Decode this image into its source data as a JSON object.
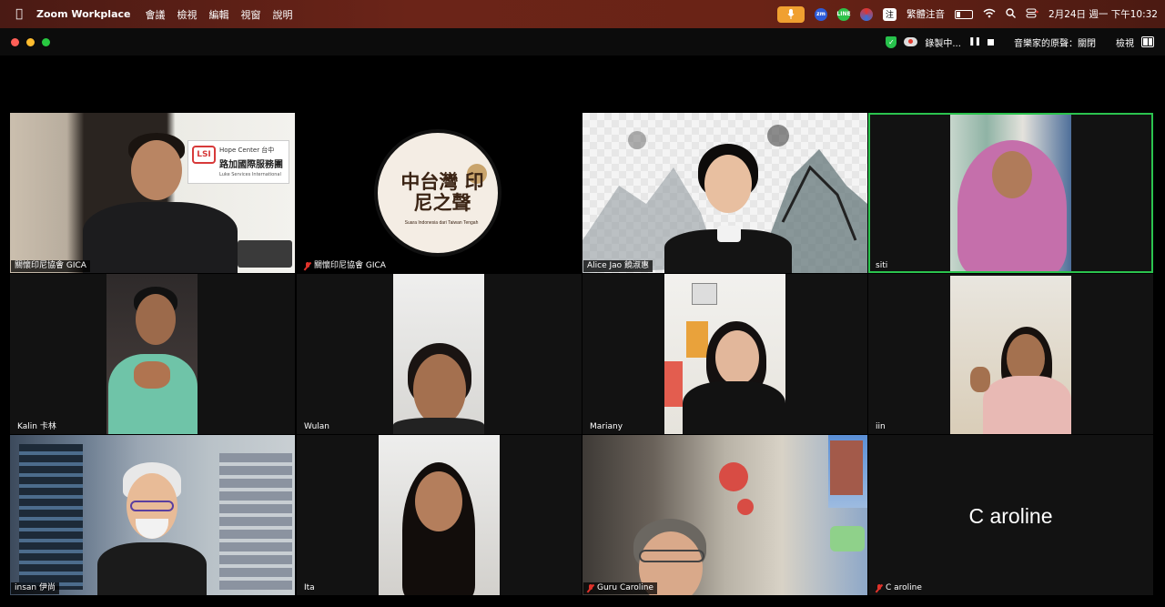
{
  "menubar": {
    "app_name": "Zoom Workplace",
    "menus": [
      "會議",
      "檢視",
      "編輯",
      "視窗",
      "說明"
    ],
    "ime_label": "注",
    "ime_name": "繁體注音",
    "date_time": "2月24日 週一 下午10:32"
  },
  "titlebar": {
    "recording_label": "錄製中...",
    "original_sound_label": "音樂家的原聲：關閉",
    "view_label": "檢視"
  },
  "participants": [
    {
      "name": "關懷印尼協會 GICA",
      "muted": false
    },
    {
      "name": "關懷印尼協會 GICA",
      "muted": true
    },
    {
      "name": "Alice Jao  饒淑惠",
      "muted": false
    },
    {
      "name": "siti",
      "muted": false,
      "active_speaker": true
    },
    {
      "name": "Kalin 卡林",
      "muted": false
    },
    {
      "name": "Wulan",
      "muted": false
    },
    {
      "name": "Mariany",
      "muted": false
    },
    {
      "name": "iin",
      "muted": false
    },
    {
      "name": "insan 伊尚",
      "muted": false
    },
    {
      "name": "Ita",
      "muted": false
    },
    {
      "name": "Guru Caroline",
      "muted": true
    },
    {
      "name": "C aroline",
      "muted": true,
      "video_off": true
    }
  ],
  "scene": {
    "office_sign_line1": "Hope Center 台中",
    "office_sign_line2": "路加國際服務團",
    "office_sign_line3": "Luke Services International",
    "logo_title": "中台灣 印尼之聲",
    "logo_subtitle": "Suara Indonesia dari Taiwan Tengah"
  },
  "colors": {
    "active_speaker_border": "#2bc34e",
    "mute_red": "#e0322a",
    "mic_pill": "#f0a030"
  }
}
